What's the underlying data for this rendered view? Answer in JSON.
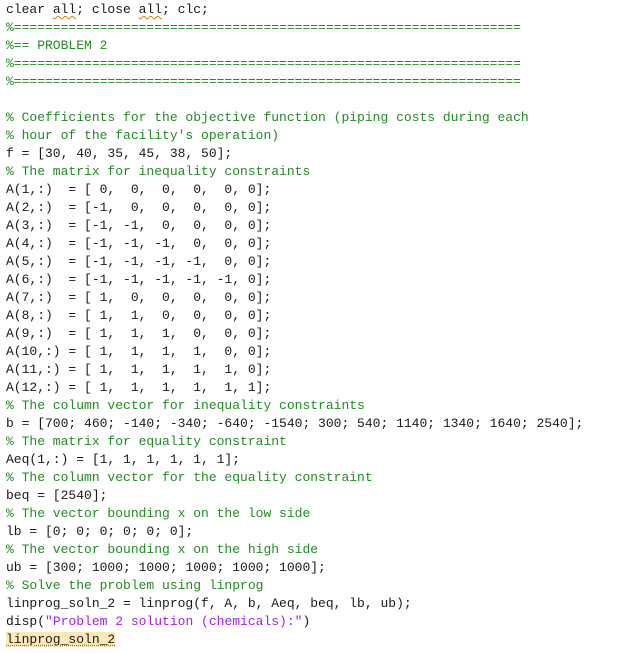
{
  "editor": {
    "lines": [
      {
        "segments": [
          {
            "text": "clear ",
            "kind": "plain"
          },
          {
            "text": "all",
            "kind": "plain",
            "squiggle": true
          },
          {
            "text": "; close ",
            "kind": "plain"
          },
          {
            "text": "all",
            "kind": "plain",
            "squiggle": true
          },
          {
            "text": "; clc;",
            "kind": "plain"
          }
        ]
      },
      {
        "segments": [
          {
            "text": "%=================================================================",
            "kind": "comment"
          }
        ]
      },
      {
        "segments": [
          {
            "text": "%== PROBLEM 2",
            "kind": "comment"
          }
        ]
      },
      {
        "segments": [
          {
            "text": "%=================================================================",
            "kind": "comment"
          }
        ]
      },
      {
        "segments": [
          {
            "text": "%=================================================================",
            "kind": "comment"
          }
        ]
      },
      {
        "segments": []
      },
      {
        "segments": [
          {
            "text": "% Coefficients for the objective function (piping costs during each",
            "kind": "comment"
          }
        ]
      },
      {
        "segments": [
          {
            "text": "% hour of the facility's operation)",
            "kind": "comment"
          }
        ]
      },
      {
        "segments": [
          {
            "text": "f = [30, 40, 35, 45, 38, 50];",
            "kind": "plain"
          }
        ]
      },
      {
        "segments": [
          {
            "text": "% The matrix for inequality constraints",
            "kind": "comment"
          }
        ]
      },
      {
        "segments": [
          {
            "text": "A(1,:)  = [ 0,  0,  0,  0,  0, 0];",
            "kind": "plain"
          }
        ]
      },
      {
        "segments": [
          {
            "text": "A(2,:)  = [-1,  0,  0,  0,  0, 0];",
            "kind": "plain"
          }
        ]
      },
      {
        "segments": [
          {
            "text": "A(3,:)  = [-1, -1,  0,  0,  0, 0];",
            "kind": "plain"
          }
        ]
      },
      {
        "segments": [
          {
            "text": "A(4,:)  = [-1, -1, -1,  0,  0, 0];",
            "kind": "plain"
          }
        ]
      },
      {
        "segments": [
          {
            "text": "A(5,:)  = [-1, -1, -1, -1,  0, 0];",
            "kind": "plain"
          }
        ]
      },
      {
        "segments": [
          {
            "text": "A(6,:)  = [-1, -1, -1, -1, -1, 0];",
            "kind": "plain"
          }
        ]
      },
      {
        "segments": [
          {
            "text": "A(7,:)  = [ 1,  0,  0,  0,  0, 0];",
            "kind": "plain"
          }
        ]
      },
      {
        "segments": [
          {
            "text": "A(8,:)  = [ 1,  1,  0,  0,  0, 0];",
            "kind": "plain"
          }
        ]
      },
      {
        "segments": [
          {
            "text": "A(9,:)  = [ 1,  1,  1,  0,  0, 0];",
            "kind": "plain"
          }
        ]
      },
      {
        "segments": [
          {
            "text": "A(10,:) = [ 1,  1,  1,  1,  0, 0];",
            "kind": "plain"
          }
        ]
      },
      {
        "segments": [
          {
            "text": "A(11,:) = [ 1,  1,  1,  1,  1, 0];",
            "kind": "plain"
          }
        ]
      },
      {
        "segments": [
          {
            "text": "A(12,:) = [ 1,  1,  1,  1,  1, 1];",
            "kind": "plain"
          }
        ]
      },
      {
        "segments": [
          {
            "text": "% The column vector for inequality constraints",
            "kind": "comment"
          }
        ]
      },
      {
        "segments": [
          {
            "text": "b = [700; 460; -140; -340; -640; -1540; 300; 540; 1140; 1340; 1640; 2540];",
            "kind": "plain"
          }
        ]
      },
      {
        "segments": [
          {
            "text": "% The matrix for equality constraint",
            "kind": "comment"
          }
        ]
      },
      {
        "segments": [
          {
            "text": "Aeq(1,:) = [1, 1, 1, 1, 1, 1];",
            "kind": "plain"
          }
        ]
      },
      {
        "segments": [
          {
            "text": "% The column vector for the equality constraint",
            "kind": "comment"
          }
        ]
      },
      {
        "segments": [
          {
            "text": "beq = [2540];",
            "kind": "plain"
          }
        ]
      },
      {
        "segments": [
          {
            "text": "% The vector bounding x on the low side",
            "kind": "comment"
          }
        ]
      },
      {
        "segments": [
          {
            "text": "lb = [0; 0; 0; 0; 0; 0];",
            "kind": "plain"
          }
        ]
      },
      {
        "segments": [
          {
            "text": "% The vector bounding x on the high side",
            "kind": "comment"
          }
        ]
      },
      {
        "segments": [
          {
            "text": "ub = [300; 1000; 1000; 1000; 1000; 1000];",
            "kind": "plain"
          }
        ]
      },
      {
        "segments": [
          {
            "text": "% Solve the problem using linprog",
            "kind": "comment"
          }
        ]
      },
      {
        "segments": [
          {
            "text": "linprog_soln_2 = linprog(f, A, b, Aeq, beq, lb, ub);",
            "kind": "plain"
          }
        ]
      },
      {
        "segments": [
          {
            "text": "disp(",
            "kind": "plain"
          },
          {
            "text": "\"Problem 2 solution (chemicals):\"",
            "kind": "string"
          },
          {
            "text": ")",
            "kind": "plain"
          }
        ]
      },
      {
        "segments": [
          {
            "text": "linprog_soln_2",
            "kind": "plain",
            "highlight": true
          }
        ]
      }
    ]
  },
  "colors": {
    "comment": "#228b22",
    "string": "#a020f0",
    "plain": "#1a1a1a",
    "highlight": "#fbe9b7",
    "squiggle": "#e07b00"
  }
}
